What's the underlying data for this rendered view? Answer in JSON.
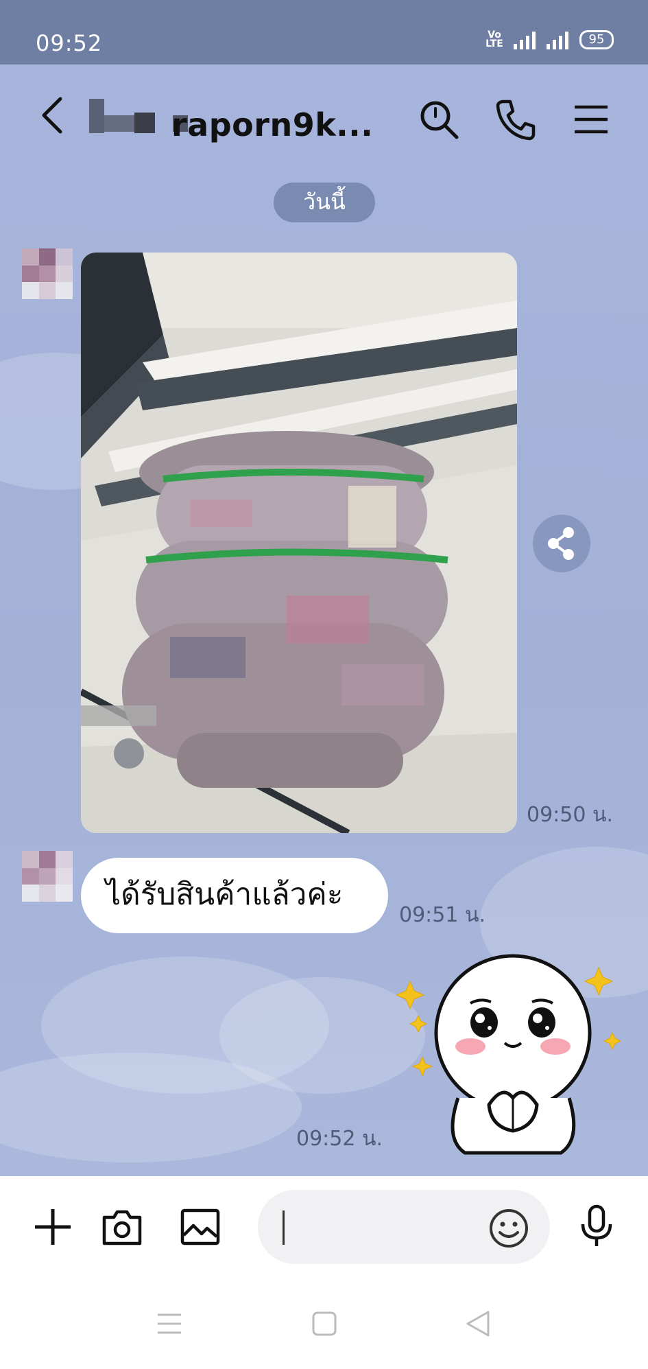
{
  "status_bar": {
    "time": "09:52",
    "volte": "Vo LTE",
    "battery": "95"
  },
  "header": {
    "title": "raporn9k...",
    "icons": [
      "back-icon",
      "search-icon",
      "phone-icon",
      "menu-icon"
    ]
  },
  "date_separator": "วันนี้",
  "messages": [
    {
      "type": "image",
      "description_icon": "photo-message",
      "time": "09:50 น."
    },
    {
      "type": "text",
      "text": "ได้รับสินค้าแล้วค่ะ",
      "time": "09:51 น."
    },
    {
      "type": "sticker",
      "time": "09:52 น."
    }
  ],
  "input_bar": {
    "icons": [
      "plus-icon",
      "camera-icon",
      "image-icon",
      "emoji-icon",
      "mic-icon"
    ],
    "placeholder": ""
  },
  "nav_bar": {
    "icons": [
      "recents-icon",
      "home-icon",
      "back-nav-icon"
    ]
  },
  "colors": {
    "chat_background": "#a6b4d8",
    "status_bar": "#6f7fa3",
    "date_pill": "#7a8bb2",
    "bubble": "#ffffff"
  }
}
